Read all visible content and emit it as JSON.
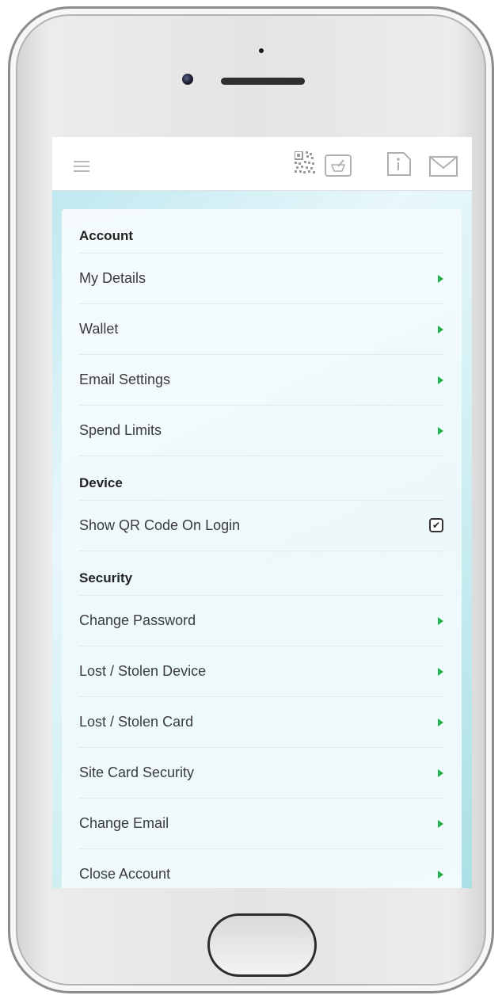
{
  "header": {
    "icons": [
      "menu-icon",
      "qr-code-icon",
      "mortar-pestle-icon",
      "info-icon",
      "envelope-icon"
    ]
  },
  "settings": {
    "sections": [
      {
        "title": "Account",
        "items": [
          {
            "label": "My Details",
            "control": "arrow"
          },
          {
            "label": "Wallet",
            "control": "arrow"
          },
          {
            "label": "Email Settings",
            "control": "arrow"
          },
          {
            "label": "Spend Limits",
            "control": "arrow"
          }
        ]
      },
      {
        "title": "Device",
        "items": [
          {
            "label": "Show QR Code On Login",
            "control": "checkbox",
            "checked": true
          }
        ]
      },
      {
        "title": "Security",
        "items": [
          {
            "label": "Change Password",
            "control": "arrow"
          },
          {
            "label": "Lost / Stolen Device",
            "control": "arrow"
          },
          {
            "label": "Lost / Stolen Card",
            "control": "arrow"
          },
          {
            "label": "Site Card Security",
            "control": "arrow"
          },
          {
            "label": "Change Email",
            "control": "arrow"
          },
          {
            "label": "Close Account",
            "control": "arrow"
          }
        ]
      }
    ]
  },
  "colors": {
    "accent_arrow": "#22b24c",
    "section_text": "#222222",
    "item_text": "#3b3b3b"
  }
}
